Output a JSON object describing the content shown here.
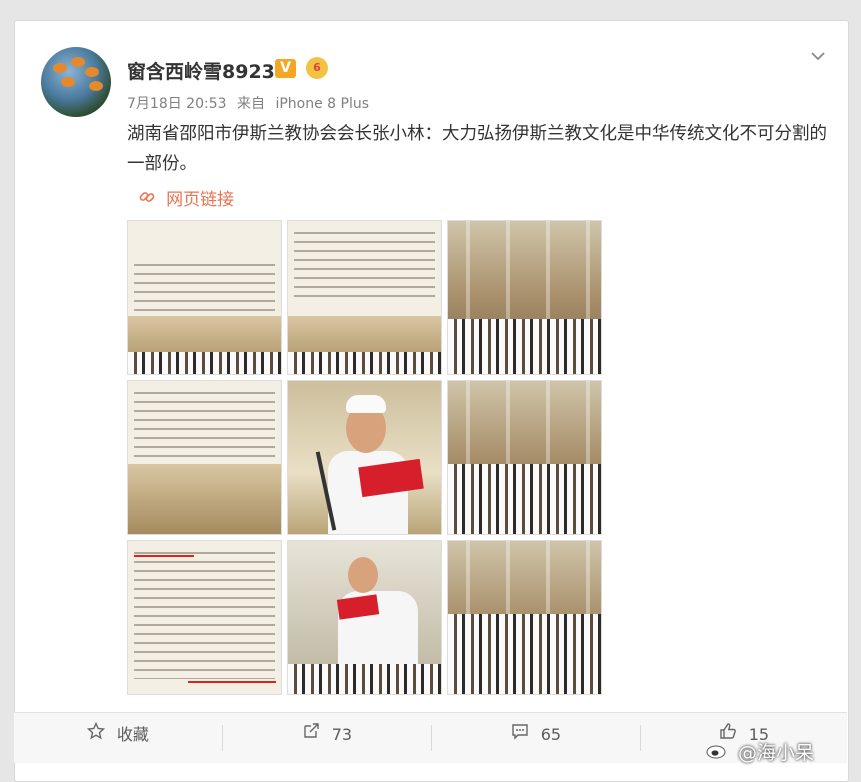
{
  "post": {
    "username": "窗含西岭雪8923",
    "verified_badge": "V",
    "level_badge": "6",
    "time": "7月18日 20:53",
    "source_prefix": "来自",
    "source": "iPhone 8 Plus",
    "content": "湖南省邵阳市伊斯兰教协会会长张小林：大力弘扬伊斯兰教文化是中华传统文化不可分割的一部份。",
    "link_label": "网页链接"
  },
  "actions": {
    "favorite_label": "收藏",
    "repost_count": "73",
    "comment_count": "65",
    "like_count": "15"
  },
  "watermark": "@海小呆",
  "icons": {
    "more": "chevron-down-icon",
    "link": "link-chain-icon",
    "favorite": "star-outline-icon",
    "repost": "repost-arrow-icon",
    "comment": "comment-bubble-icon",
    "like": "thumbs-up-icon",
    "weibo": "weibo-logo-icon"
  },
  "colors": {
    "accent_orange": "#eb7350",
    "text_dark": "#333333",
    "meta_gray": "#808080",
    "badge_gold": "#f5a623"
  }
}
